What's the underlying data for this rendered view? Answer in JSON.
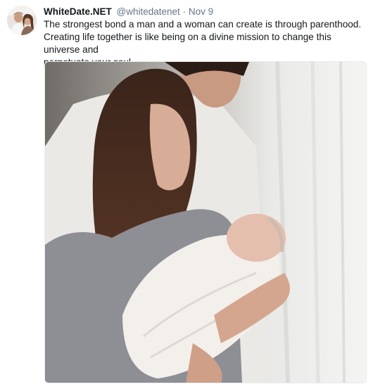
{
  "tweet": {
    "display_name": "WhiteDate.NET",
    "handle": "@whitedatenet",
    "separator": "·",
    "timestamp": "Nov 9",
    "text_lines": [
      "The strongest bond a man and a woman can create is through parenthood.",
      "Creating life together is like being on a divine mission to change this universe and",
      "perpetuate your soul."
    ]
  },
  "colors": {
    "name": "#14171a",
    "secondary_text": "#657786",
    "background": "#ffffff",
    "media_border": "#e6ecf0"
  }
}
